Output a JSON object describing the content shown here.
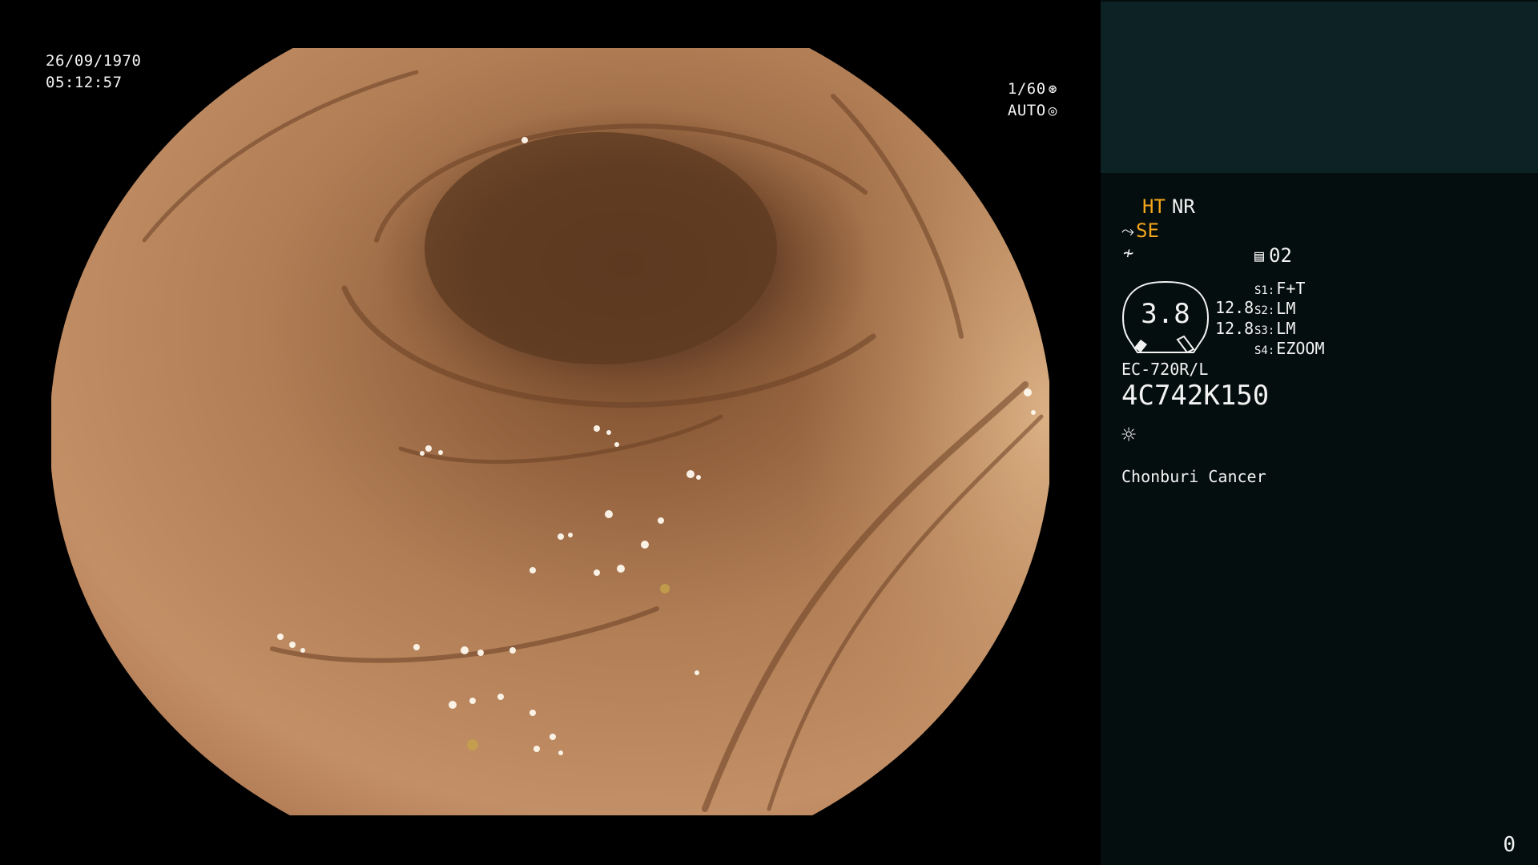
{
  "overlay": {
    "date": "26/09/1970",
    "time": "05:12:57",
    "shutter": "1/60",
    "shutter_icon": "shutter-icon",
    "exposure_mode": "AUTO",
    "exposure_icon": "exposure-icon"
  },
  "panel": {
    "ht": "HT",
    "nr": "NR",
    "se": "SE",
    "enhance_icon": "enhance-icon",
    "curve_icon": "curve-icon",
    "memo_value": "02",
    "memo_icon": "memo-icon",
    "iris_value": "3.8",
    "brightness_1": "12.8",
    "brightness_2": "12.8",
    "switches": [
      {
        "key": "S1:",
        "value": "F+T"
      },
      {
        "key": "S2:",
        "value": "LM"
      },
      {
        "key": "S3:",
        "value": "LM"
      },
      {
        "key": "S4:",
        "value": "EZOOM"
      }
    ],
    "scope_model": "EC-720R/L",
    "scope_serial": "4C742K150",
    "light_icon": "light-icon",
    "hospital": "Chonburi Cancer",
    "counter": "0"
  },
  "colors": {
    "panel_bg": "#050e0e",
    "thumb_bg": "#0d2224",
    "accent_orange": "#f3a51c",
    "text": "#f2f2f2"
  }
}
